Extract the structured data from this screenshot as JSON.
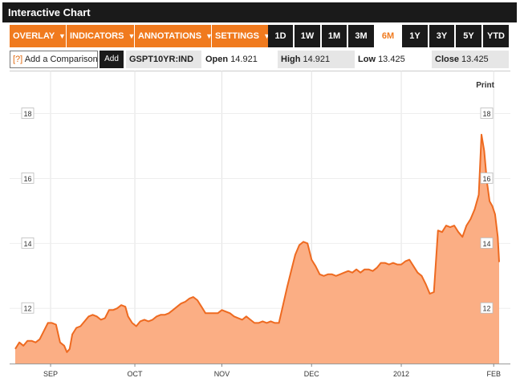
{
  "title": "Interactive Chart",
  "menus": [
    {
      "label": "OVERLAY",
      "arrow": "▼"
    },
    {
      "label": "INDICATORS",
      "arrow": "▼"
    },
    {
      "label": "ANNOTATIONS",
      "arrow": "▼"
    },
    {
      "label": "SETTINGS",
      "arrow": "▼"
    }
  ],
  "ranges": [
    "1D",
    "1W",
    "1M",
    "3M",
    "6M",
    "1Y",
    "3Y",
    "5Y",
    "YTD"
  ],
  "active_range": "6M",
  "comparison": {
    "number": "[?]",
    "label": "Add a Comparison",
    "add_label": "Add"
  },
  "ticker": "GSPT10YR:IND",
  "quote": {
    "open_label": "Open",
    "open": "14.921",
    "high_label": "High",
    "high": "14.921",
    "low_label": "Low",
    "low": "13.425",
    "close_label": "Close",
    "close": "13.425"
  },
  "print_label": "Print",
  "colors": {
    "accent": "#f07a1e",
    "fill": "#fbae84",
    "line": "#ee6a20",
    "dark": "#1a1a1a"
  },
  "chart_data": {
    "type": "area",
    "title": "",
    "xlabel": "",
    "ylabel": "",
    "ylim": [
      10.3,
      19.2
    ],
    "yticks": [
      12,
      14,
      16,
      18
    ],
    "xtick_labels": [
      {
        "label": "SEP",
        "x": 13
      },
      {
        "label": "OCT",
        "x": 44
      },
      {
        "label": "NOV",
        "x": 76
      },
      {
        "label": "DEC",
        "x": 109
      },
      {
        "label": "2012",
        "x": 142
      },
      {
        "label": "FEB",
        "x": 176
      }
    ],
    "grid": true,
    "series": [
      {
        "values": [
          [
            0,
            10.75
          ],
          [
            1.5,
            10.95
          ],
          [
            3,
            10.85
          ],
          [
            4.5,
            11.0
          ],
          [
            6,
            11.0
          ],
          [
            7.5,
            10.95
          ],
          [
            9,
            11.05
          ],
          [
            10.5,
            11.3
          ],
          [
            12,
            11.55
          ],
          [
            13.5,
            11.55
          ],
          [
            15,
            11.5
          ],
          [
            16.5,
            10.95
          ],
          [
            18,
            10.85
          ],
          [
            19,
            10.65
          ],
          [
            20,
            10.75
          ],
          [
            21,
            11.2
          ],
          [
            22.5,
            11.4
          ],
          [
            24,
            11.45
          ],
          [
            25.5,
            11.6
          ],
          [
            27,
            11.75
          ],
          [
            28.5,
            11.8
          ],
          [
            30,
            11.75
          ],
          [
            31.5,
            11.65
          ],
          [
            33,
            11.7
          ],
          [
            34.5,
            11.95
          ],
          [
            36,
            11.95
          ],
          [
            37.5,
            12.0
          ],
          [
            39,
            12.1
          ],
          [
            40.5,
            12.05
          ],
          [
            41.5,
            11.75
          ],
          [
            43,
            11.55
          ],
          [
            44.5,
            11.45
          ],
          [
            46,
            11.6
          ],
          [
            47.5,
            11.65
          ],
          [
            49,
            11.6
          ],
          [
            50.5,
            11.65
          ],
          [
            52,
            11.75
          ],
          [
            53.5,
            11.8
          ],
          [
            55,
            11.8
          ],
          [
            56.5,
            11.85
          ],
          [
            58,
            11.95
          ],
          [
            59.5,
            12.05
          ],
          [
            61,
            12.15
          ],
          [
            62.5,
            12.2
          ],
          [
            64,
            12.3
          ],
          [
            65.5,
            12.35
          ],
          [
            67,
            12.25
          ],
          [
            68.5,
            12.05
          ],
          [
            70,
            11.85
          ],
          [
            71.5,
            11.85
          ],
          [
            73,
            11.85
          ],
          [
            74.5,
            11.85
          ],
          [
            76,
            11.95
          ],
          [
            77.5,
            11.9
          ],
          [
            79,
            11.85
          ],
          [
            80.5,
            11.75
          ],
          [
            82,
            11.7
          ],
          [
            83.5,
            11.65
          ],
          [
            85,
            11.75
          ],
          [
            86.5,
            11.65
          ],
          [
            88,
            11.55
          ],
          [
            89.5,
            11.55
          ],
          [
            91,
            11.6
          ],
          [
            92.5,
            11.55
          ],
          [
            94,
            11.6
          ],
          [
            95.5,
            11.55
          ],
          [
            97,
            11.55
          ],
          [
            98.5,
            12.1
          ],
          [
            100,
            12.65
          ],
          [
            101.5,
            13.15
          ],
          [
            103,
            13.65
          ],
          [
            104.5,
            13.95
          ],
          [
            106,
            14.05
          ],
          [
            107.5,
            14.0
          ],
          [
            109,
            13.5
          ],
          [
            110.5,
            13.3
          ],
          [
            112,
            13.05
          ],
          [
            113.5,
            13.0
          ],
          [
            115,
            13.05
          ],
          [
            116.5,
            13.05
          ],
          [
            118,
            13.0
          ],
          [
            119.5,
            13.05
          ],
          [
            121,
            13.1
          ],
          [
            122.5,
            13.15
          ],
          [
            124,
            13.1
          ],
          [
            125.5,
            13.2
          ],
          [
            127,
            13.1
          ],
          [
            128.5,
            13.2
          ],
          [
            130,
            13.2
          ],
          [
            131.5,
            13.15
          ],
          [
            133,
            13.25
          ],
          [
            134.5,
            13.4
          ],
          [
            136,
            13.4
          ],
          [
            137.5,
            13.35
          ],
          [
            139,
            13.4
          ],
          [
            140.5,
            13.35
          ],
          [
            142,
            13.35
          ],
          [
            143.5,
            13.45
          ],
          [
            145,
            13.5
          ],
          [
            146.5,
            13.3
          ],
          [
            148,
            13.1
          ],
          [
            149.5,
            13.0
          ],
          [
            151,
            12.75
          ],
          [
            152.5,
            12.45
          ],
          [
            154,
            12.5
          ],
          [
            155.5,
            14.4
          ],
          [
            157,
            14.35
          ],
          [
            158.5,
            14.55
          ],
          [
            160,
            14.5
          ],
          [
            161.5,
            14.55
          ],
          [
            163,
            14.35
          ],
          [
            164.5,
            14.2
          ],
          [
            166,
            14.55
          ],
          [
            167.5,
            14.75
          ],
          [
            169,
            15.05
          ],
          [
            170.5,
            15.5
          ],
          [
            171.5,
            17.35
          ],
          [
            172.5,
            16.85
          ],
          [
            173.5,
            15.9
          ],
          [
            174.5,
            15.3
          ],
          [
            175.5,
            15.15
          ],
          [
            176.5,
            14.9
          ],
          [
            177.5,
            14.2
          ],
          [
            178,
            13.425
          ]
        ]
      }
    ]
  }
}
